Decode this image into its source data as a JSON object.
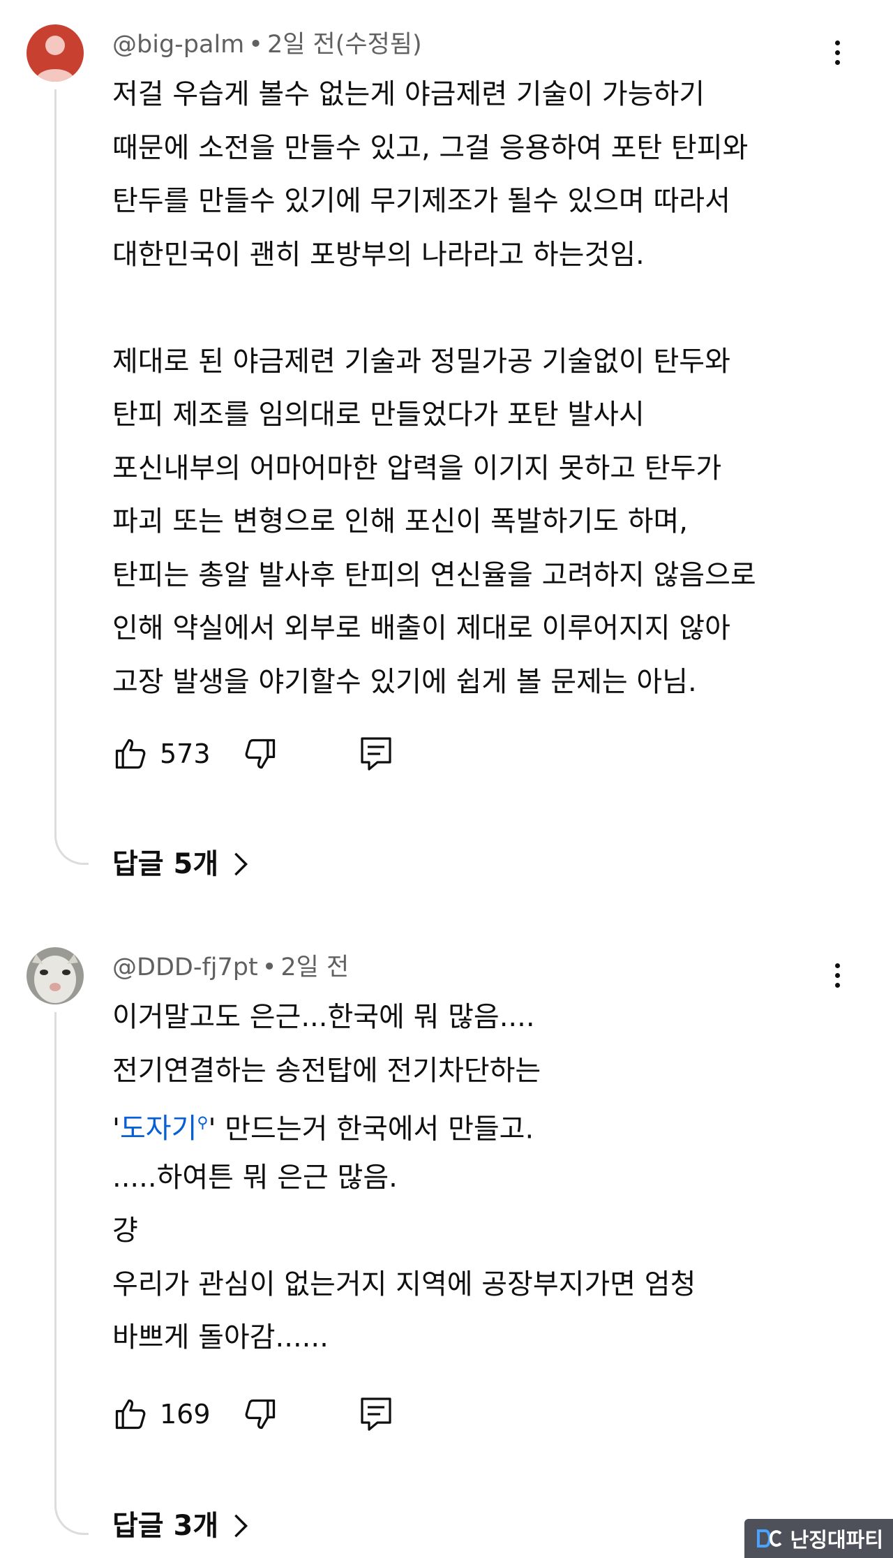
{
  "comments": [
    {
      "handle": "@big-palm",
      "time": "2일 전(수정됨)",
      "lines": [
        "저걸 우습게 볼수 없는게 야금제련 기술이 가능하기",
        "때문에 소전을 만들수 있고, 그걸 응용하여 포탄 탄피와",
        "탄두를 만들수 있기에 무기제조가 될수 있으며 따라서",
        "대한민국이 괜히 포방부의 나라라고 하는것임.",
        "",
        "제대로 된 야금제련 기술과 정밀가공 기술없이 탄두와",
        "탄피 제조를 임의대로 만들었다가 포탄 발사시",
        "포신내부의 어마어마한 압력을 이기지 못하고 탄두가",
        "파괴 또는 변형으로 인해 포신이 폭발하기도 하며,",
        "탄피는 총알 발사후 탄피의 연신율을 고려하지 않음으로",
        "인해 약실에서 외부로 배출이 제대로 이루어지지 않아",
        "고장 발생을 야기할수 있기에 쉽게 볼 문제는 아님."
      ],
      "likes": "573",
      "replies_label": "답글 5개"
    },
    {
      "handle": "@DDD-fj7pt",
      "time": "2일 전",
      "lines": [
        "이거말고도 은근...한국에 뭐 많음....",
        "전기연결하는 송전탑에 전기차단하는"
      ],
      "link_line": {
        "prefix": "'",
        "link_text": "도자기",
        "suffix": "' 만드는거 한국에서 만들고."
      },
      "lines_after": [
        ".....하여튼 뭐 은근 많음.",
        "걍",
        "우리가 관심이 없는거지 지역에 공장부지가면 엄청",
        "바쁘게 돌아감......"
      ],
      "likes": "169",
      "replies_label": "답글 3개"
    }
  ],
  "icons": {
    "like": "thumbs-up-icon",
    "dislike": "thumbs-down-icon",
    "reply": "reply-comment-icon",
    "more": "more-vertical-icon",
    "chevron": "chevron-right-icon",
    "search": "search-icon"
  },
  "watermark": {
    "text": "난징대파티"
  },
  "colors": {
    "text": "#0f0f0f",
    "meta": "#606060",
    "link": "#065fd4",
    "thread": "#dcdcdc",
    "avatar1": "#c0392b"
  }
}
